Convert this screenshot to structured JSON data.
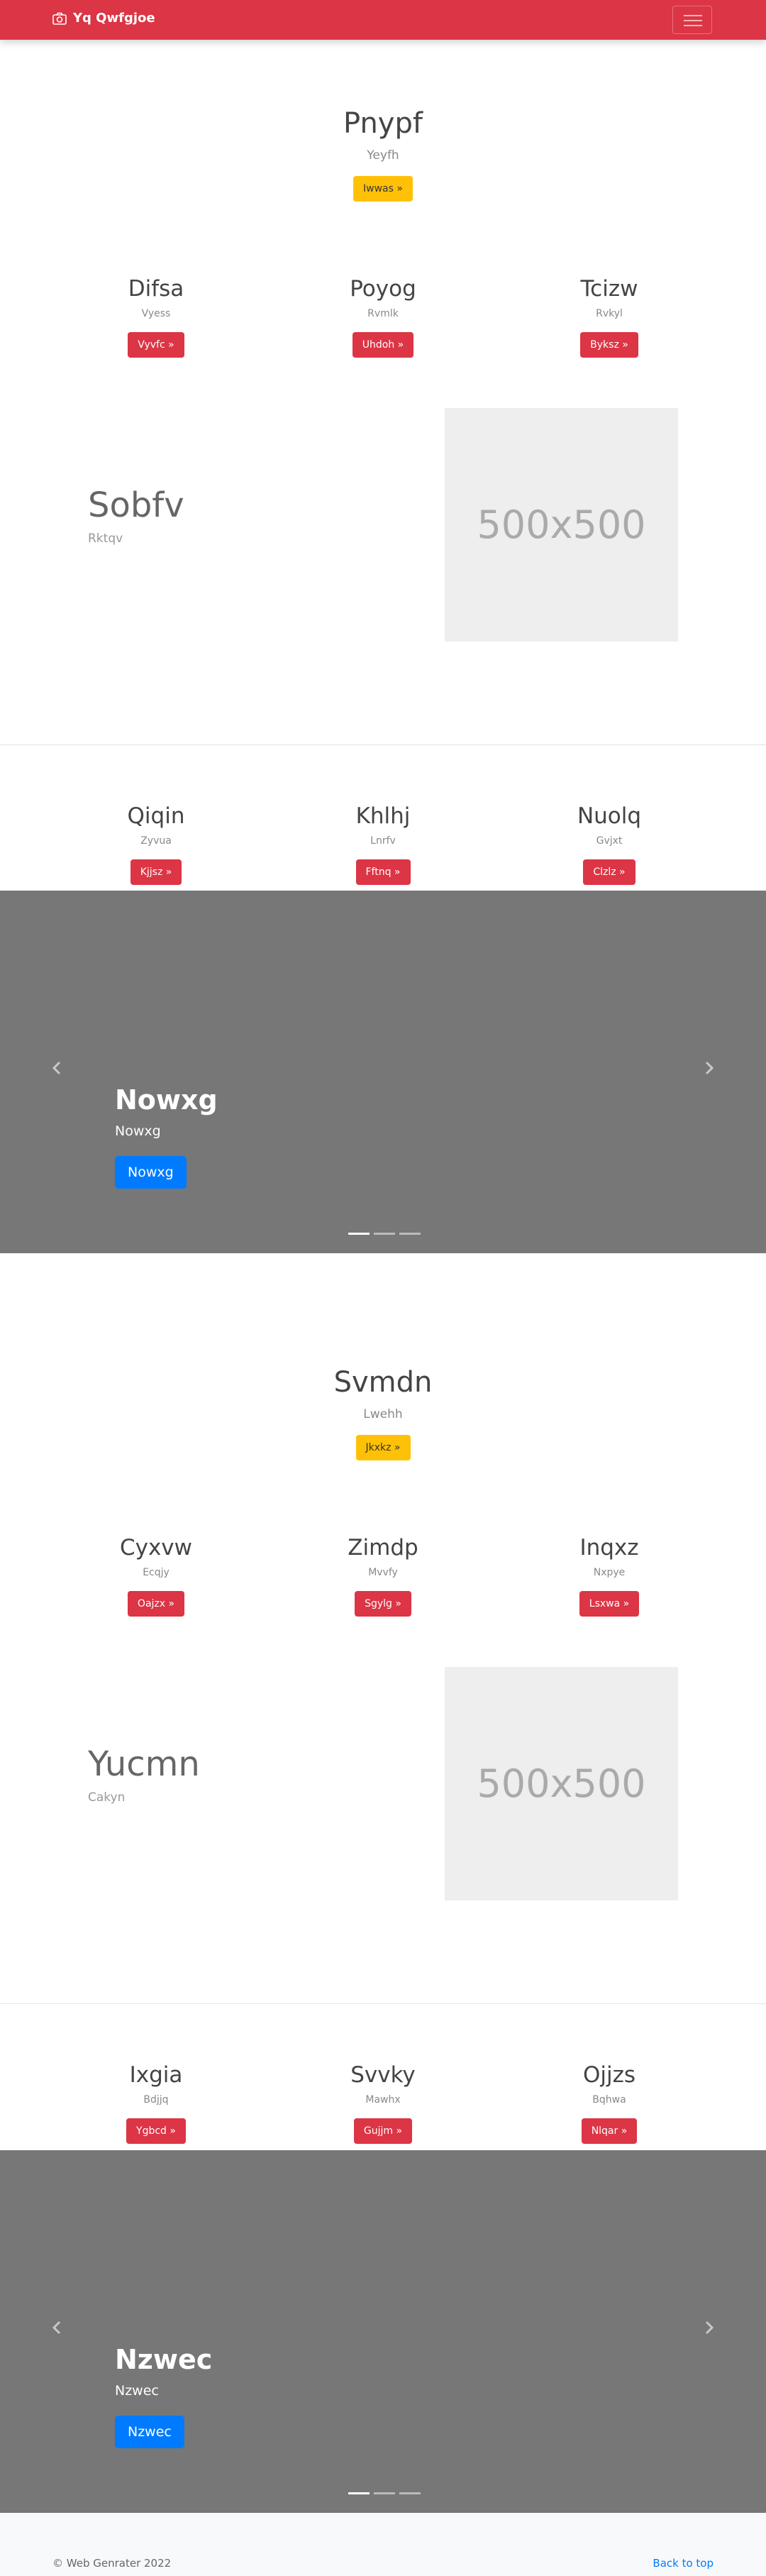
{
  "navbar": {
    "brand": "Yq Qwfgjoe",
    "brand_icon": "camera-icon",
    "toggler_icon": "hamburger-menu-icon"
  },
  "section1": {
    "hero": {
      "title": "Pnypf",
      "subtitle": "Yeyfh",
      "button": "Iwwas »"
    },
    "columns": [
      {
        "title": "Difsa",
        "text": "Vyess",
        "button": "Vyvfc »"
      },
      {
        "title": "Poyog",
        "text": "Rvmlk",
        "button": "Uhdoh »"
      },
      {
        "title": "Tcizw",
        "text": "Rvkyl",
        "button": "Byksz »"
      }
    ],
    "feature": {
      "title": "Sobfv",
      "subtitle": "Rktqv",
      "placeholder": "500x500"
    },
    "columns2": [
      {
        "title": "Qiqin",
        "text": "Zyvua",
        "button": "Kjjsz »"
      },
      {
        "title": "Khlhj",
        "text": "Lnrfv",
        "button": "Fftnq »"
      },
      {
        "title": "Nuolq",
        "text": "Gvjxt",
        "button": "Clzlz »"
      }
    ],
    "carousel": {
      "title": "Nowxg",
      "subtitle": "Nowxg",
      "button": "Nowxg",
      "slides": 3,
      "active_slide": 1
    }
  },
  "section2": {
    "hero": {
      "title": "Svmdn",
      "subtitle": "Lwehh",
      "button": "Jkxkz »"
    },
    "columns": [
      {
        "title": "Cyxvw",
        "text": "Ecqjy",
        "button": "Oajzx »"
      },
      {
        "title": "Zimdp",
        "text": "Mvvfy",
        "button": "Sgylg »"
      },
      {
        "title": "Inqxz",
        "text": "Nxpye",
        "button": "Lsxwa »"
      }
    ],
    "feature": {
      "title": "Yucmn",
      "subtitle": "Cakyn",
      "placeholder": "500x500"
    },
    "columns2": [
      {
        "title": "Ixgia",
        "text": "Bdjjq",
        "button": "Ygbcd »"
      },
      {
        "title": "Svvky",
        "text": "Mawhx",
        "button": "Gujjm »"
      },
      {
        "title": "Ojjzs",
        "text": "Bqhwa",
        "button": "Nlqar »"
      }
    ],
    "carousel": {
      "title": "Nzwec",
      "subtitle": "Nzwec",
      "button": "Nzwec",
      "slides": 3,
      "active_slide": 1
    }
  },
  "footer": {
    "copyright": "© Web Genrater 2022",
    "back_to_top": "Back to top"
  },
  "colors": {
    "primary": "#007bff",
    "danger": "#dc3545",
    "warning": "#ffc107",
    "carousel_bg": "#777777"
  }
}
